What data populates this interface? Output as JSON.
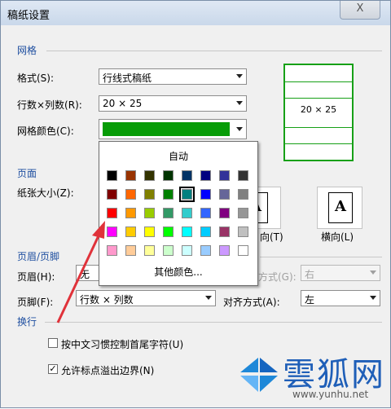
{
  "window": {
    "title": "稿纸设置",
    "close_glyph": "X"
  },
  "grid": {
    "section_title": "网格",
    "format_label": "格式(S):",
    "format_value": "行线式稿纸",
    "rowcol_label": "行数×列数(R):",
    "rowcol_value": "20 × 25",
    "color_label": "网格颜色(C):",
    "color_value": "#079c07",
    "preview_text": "20 × 25"
  },
  "page": {
    "section_title": "页面",
    "size_label": "纸张大小(Z):",
    "portrait_label": "向(T)",
    "landscape_label": "横向(L)",
    "orient_glyph": "A"
  },
  "header_footer": {
    "section_title": "页眉/页脚",
    "header_label": "页眉(H):",
    "header_value": "无",
    "header_align_label": "方式(G):",
    "header_align_value": "右",
    "footer_label": "页脚(F):",
    "footer_value": "行数 × 列数",
    "footer_align_label": "对齐方式(A):",
    "footer_align_value": "左"
  },
  "line_break": {
    "section_title": "换行",
    "opt1_label": "按中文习惯控制首尾字符(U)",
    "opt1_checked": false,
    "opt2_label": "允许标点溢出边界(N)",
    "opt2_checked": true,
    "check_glyph": "✓"
  },
  "color_picker": {
    "auto_label": "自动",
    "more_label": "其他颜色...",
    "selected_index": 12,
    "colors": [
      "#000000",
      "#993300",
      "#333300",
      "#003300",
      "#003366",
      "#000080",
      "#333399",
      "#333333",
      "#800000",
      "#ff6600",
      "#808000",
      "#008000",
      "#008080",
      "#0000ff",
      "#666699",
      "#808080",
      "#ff0000",
      "#ff9900",
      "#99cc00",
      "#339966",
      "#33cccc",
      "#3366ff",
      "#800080",
      "#969696",
      "#ff00ff",
      "#ffcc00",
      "#ffff00",
      "#00ff00",
      "#00ffff",
      "#00ccff",
      "#993366",
      "#c0c0c0",
      "#ff99cc",
      "#ffcc99",
      "#ffff99",
      "#ccffcc",
      "#ccffff",
      "#99ccff",
      "#cc99ff",
      "#ffffff"
    ]
  },
  "watermark": {
    "brand": "雲狐网",
    "url": "www.yunhu.net"
  },
  "colors": {
    "annotation_arrow": "#e0323a",
    "section_title": "#1f4fa0",
    "grid_green": "#17a017"
  }
}
